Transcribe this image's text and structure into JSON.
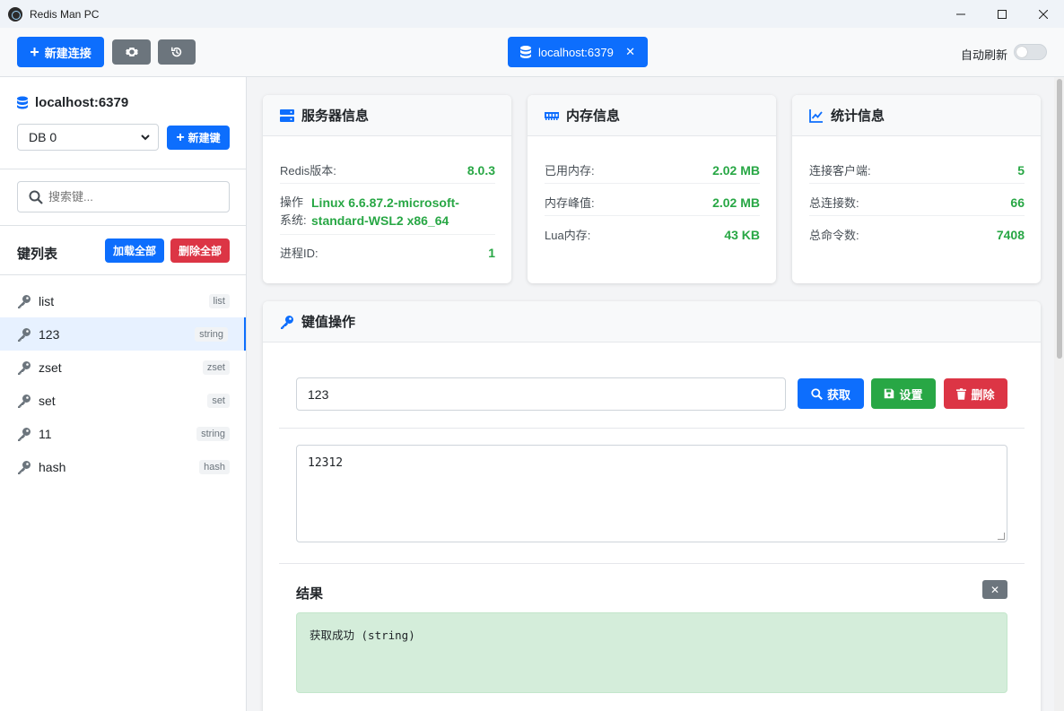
{
  "window": {
    "title": "Redis Man PC",
    "minimize": "—",
    "maximize": "☐",
    "close": "✕"
  },
  "toolbar": {
    "new_connection": "新建连接",
    "active_connection": "localhost:6379",
    "auto_refresh": "自动刷新"
  },
  "sidebar": {
    "server": "localhost:6379",
    "db_selected": "DB 0",
    "new_key": "新建键",
    "search_placeholder": "搜索键...",
    "key_list_title": "键列表",
    "load_all": "加载全部",
    "delete_all": "删除全部",
    "keys": [
      {
        "name": "list",
        "type": "list"
      },
      {
        "name": "123",
        "type": "string"
      },
      {
        "name": "zset",
        "type": "zset"
      },
      {
        "name": "set",
        "type": "set"
      },
      {
        "name": "11",
        "type": "string"
      },
      {
        "name": "hash",
        "type": "hash"
      }
    ]
  },
  "server_info": {
    "title": "服务器信息",
    "redis_version_label": "Redis版本:",
    "redis_version": "8.0.3",
    "os_label_1": "操作",
    "os_label_2": "系统:",
    "os_value_1": "Linux 6.6.87.2-microsoft-",
    "os_value_2": "standard-WSL2 x86_64",
    "pid_label": "进程ID:",
    "pid": "1"
  },
  "memory_info": {
    "title": "内存信息",
    "used_label": "已用内存:",
    "used": "2.02 MB",
    "peak_label": "内存峰值:",
    "peak": "2.02 MB",
    "lua_label": "Lua内存:",
    "lua": "43 KB"
  },
  "stats_info": {
    "title": "统计信息",
    "clients_label": "连接客户端:",
    "clients": "5",
    "connections_label": "总连接数:",
    "connections": "66",
    "commands_label": "总命令数:",
    "commands": "7408"
  },
  "key_ops": {
    "title": "键值操作",
    "key_value": "123",
    "get": "获取",
    "set": "设置",
    "delete": "删除",
    "value": "12312",
    "result_title": "结果",
    "result_close": "✕",
    "result_text": "获取成功 (string)"
  }
}
